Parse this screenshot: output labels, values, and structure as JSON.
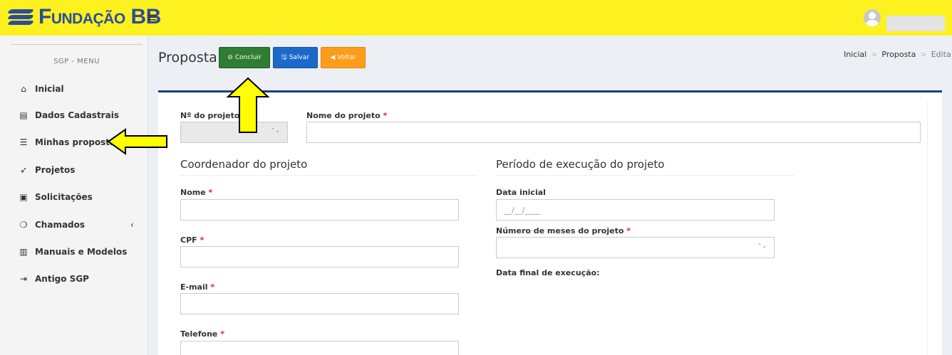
{
  "brand": {
    "logo_text": "Fundação BB",
    "logo_color": "#2b4d9c",
    "bar_color": "#fdf11f"
  },
  "topbar": {
    "menu_icon": "hamburger-icon",
    "menu_glyph": "≡"
  },
  "sidebar": {
    "header": "SGP - MENU",
    "items": [
      {
        "label": "Inicial",
        "icon": "home-icon",
        "glyph": "⌂"
      },
      {
        "label": "Dados Cadastrais",
        "icon": "document-icon",
        "glyph": "▤"
      },
      {
        "label": "Minhas propostas",
        "icon": "list-icon",
        "glyph": "☰"
      },
      {
        "label": "Projetos",
        "icon": "rocket-icon",
        "glyph": "➶"
      },
      {
        "label": "Solicitações",
        "icon": "money-icon",
        "glyph": "▣"
      },
      {
        "label": "Chamados",
        "icon": "chat-icon",
        "glyph": "❍"
      },
      {
        "label": "Manuais e Modelos",
        "icon": "book-icon",
        "glyph": "▥"
      },
      {
        "label": "Antigo SGP",
        "icon": "sign-in-icon",
        "glyph": "⇥"
      }
    ],
    "chevron_glyph": "‹"
  },
  "header": {
    "title": "Proposta",
    "buttons": {
      "concluir": {
        "label": "Concluir",
        "icon_glyph": "⊘",
        "color": "#2f7d32"
      },
      "salvar": {
        "label": "Salvar",
        "icon_glyph": "🖫",
        "color": "#1b6ac9"
      },
      "voltar": {
        "label": "Voltar",
        "icon_glyph": "◀",
        "color": "#ff9c1a"
      }
    },
    "breadcrumb": [
      "Inicial",
      "Proposta",
      "Edita"
    ],
    "breadcrumb_sep": ">"
  },
  "form": {
    "project_number_label": "Nº do projeto",
    "project_name_label": "Nome do projeto",
    "coordinator_section": "Coordenador do projeto",
    "period_section": "Período de execução do projeto",
    "name_label": "Nome",
    "cpf_label": "CPF",
    "email_label": "E-mail",
    "phone_label": "Telefone",
    "start_date_label": "Data inicial",
    "start_date_placeholder": "__/__/____",
    "months_label": "Número de meses do projeto",
    "end_date_label": "Data final de execução:",
    "required_mark": "*",
    "spinner_glyph": "⌃⌄"
  },
  "annotations": {
    "arrow_color": "#ffff00"
  }
}
